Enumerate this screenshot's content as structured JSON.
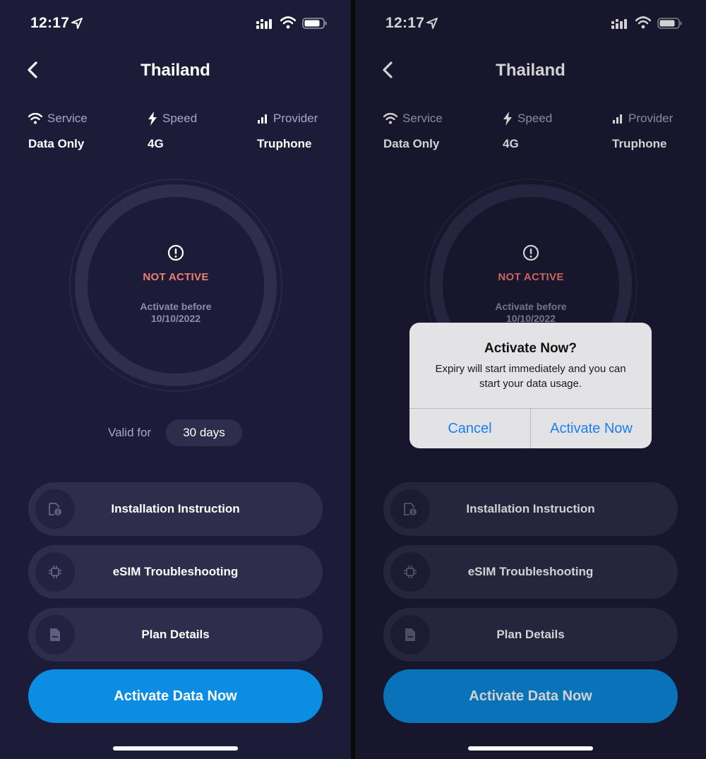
{
  "status_bar": {
    "time": "12:17"
  },
  "header": {
    "title": "Thailand"
  },
  "info": {
    "service": {
      "label": "Service",
      "value": "Data Only"
    },
    "speed": {
      "label": "Speed",
      "value": "4G"
    },
    "provider": {
      "label": "Provider",
      "value": "Truphone"
    }
  },
  "status": {
    "text": "NOT ACTIVE",
    "activate_before_label": "Activate before",
    "activate_before_date": "10/10/2022"
  },
  "validity": {
    "label": "Valid for",
    "value": "30 days"
  },
  "menu": {
    "installation": "Installation Instruction",
    "troubleshooting": "eSIM Troubleshooting",
    "plan_details": "Plan Details"
  },
  "primary_button": "Activate Data Now",
  "dialog": {
    "title": "Activate Now?",
    "message": "Expiry will start immediately and you can start your data usage.",
    "cancel": "Cancel",
    "confirm": "Activate Now"
  },
  "colors": {
    "background": "#1d1c38",
    "card": "#2e2e4c",
    "accent_blue": "#0a8de2",
    "status_red": "#f07d72",
    "dialog_button_blue": "#1a7ff5"
  }
}
